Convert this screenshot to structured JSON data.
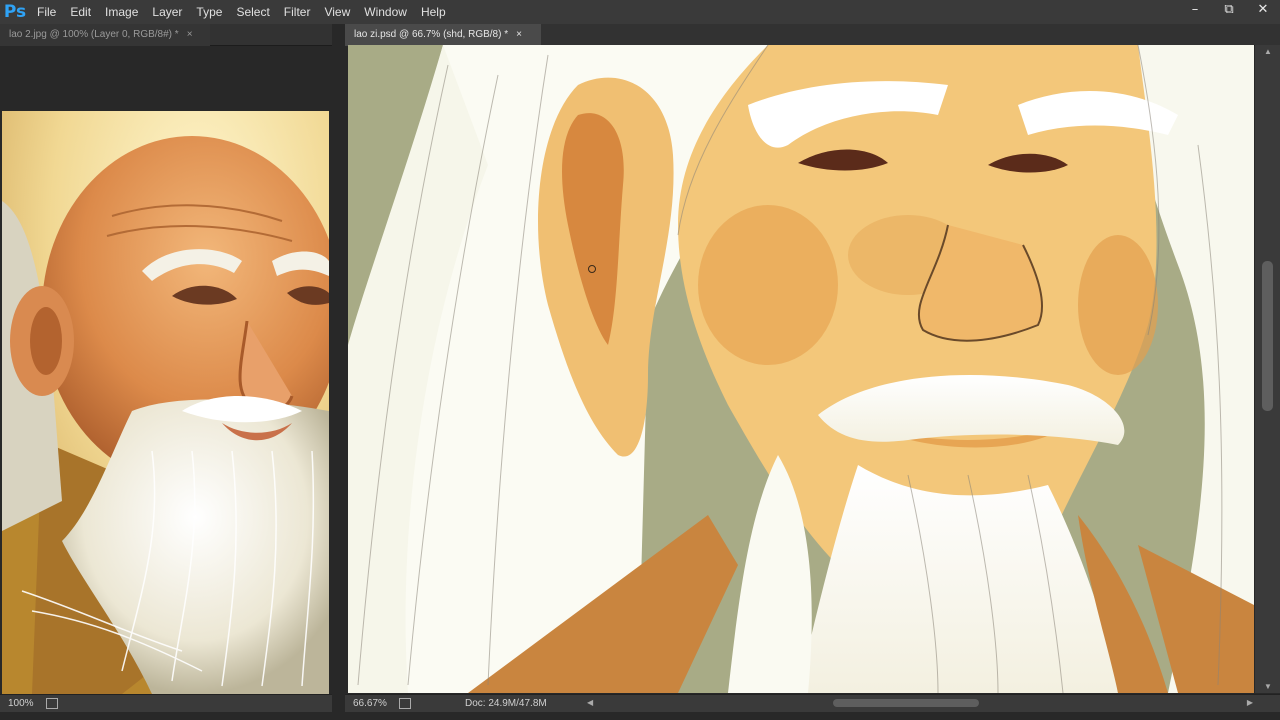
{
  "app": {
    "logo": "Ps"
  },
  "menu": [
    "File",
    "Edit",
    "Image",
    "Layer",
    "Type",
    "Select",
    "Filter",
    "View",
    "Window",
    "Help"
  ],
  "window_controls": {
    "minimize": "–",
    "restore": "⧉",
    "close": "✕"
  },
  "documents": [
    {
      "tab_title": "lao 2.jpg @ 100% (Layer 0, RGB/8#) *",
      "close": "×",
      "zoom": "100%",
      "active": false
    },
    {
      "tab_title": "lao zi.psd @ 66.7% (shd, RGB/8) *",
      "close": "×",
      "zoom": "66.67%",
      "doc_size": "Doc: 24.9M/47.8M",
      "active": true
    }
  ],
  "icons": {
    "status_info": "doc-info-icon",
    "status_menu": "status-menu-arrow-icon",
    "brush_cursor": "brush-cursor-icon"
  },
  "colors": {
    "skin": "#f3c77a",
    "beard": "#fbfaf0",
    "robe": "#c9853f",
    "background": "#a8ab86"
  }
}
